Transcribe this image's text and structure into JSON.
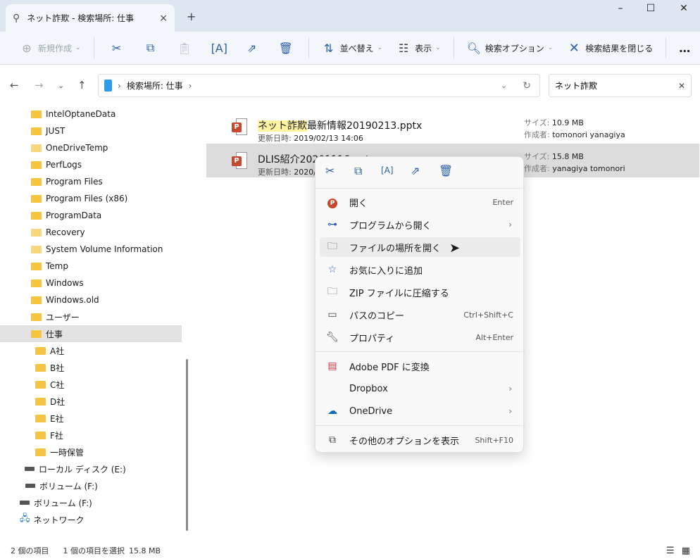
{
  "window": {
    "tab_title": "ネット詐欺 - 検索場所: 仕事",
    "new_tab": "+",
    "close_tab": "×",
    "minimize": "–",
    "maximize": "☐",
    "close": "✕"
  },
  "toolbar": {
    "new": "新規作成",
    "sort": "並べ替え",
    "view": "表示",
    "search_options": "検索オプション",
    "close_search": "検索結果を閉じる",
    "more": "…"
  },
  "address": {
    "path": "検索場所: 仕事",
    "search_value": "ネット詐欺"
  },
  "sidebar": {
    "items": [
      {
        "label": "IntelOptaneData",
        "type": "folder"
      },
      {
        "label": "JUST",
        "type": "folder"
      },
      {
        "label": "OneDriveTemp",
        "type": "folder-light"
      },
      {
        "label": "PerfLogs",
        "type": "folder"
      },
      {
        "label": "Program Files",
        "type": "folder"
      },
      {
        "label": "Program Files (x86)",
        "type": "folder"
      },
      {
        "label": "ProgramData",
        "type": "folder"
      },
      {
        "label": "Recovery",
        "type": "folder-light"
      },
      {
        "label": "System Volume Information",
        "type": "folder-light"
      },
      {
        "label": "Temp",
        "type": "folder"
      },
      {
        "label": "Windows",
        "type": "folder"
      },
      {
        "label": "Windows.old",
        "type": "folder"
      },
      {
        "label": "ユーザー",
        "type": "folder"
      },
      {
        "label": "仕事",
        "type": "folder",
        "selected": true
      },
      {
        "label": "A社",
        "type": "folder",
        "sub": true
      },
      {
        "label": "B社",
        "type": "folder",
        "sub": true
      },
      {
        "label": "C社",
        "type": "folder",
        "sub": true
      },
      {
        "label": "D社",
        "type": "folder",
        "sub": true
      },
      {
        "label": "E社",
        "type": "folder",
        "sub": true
      },
      {
        "label": "F社",
        "type": "folder",
        "sub": true
      },
      {
        "label": "一時保管",
        "type": "folder",
        "sub": true
      },
      {
        "label": "ローカル ディスク (E:)",
        "type": "drive"
      },
      {
        "label": "ボリューム (F:)",
        "type": "drive"
      },
      {
        "label": "ボリューム (F:)",
        "type": "drive2"
      },
      {
        "label": "ネットワーク",
        "type": "network"
      }
    ]
  },
  "files": [
    {
      "highlight": "ネット詐欺",
      "name_rest": "最新情報20190213.pptx",
      "modified_label": "更新日時:",
      "modified": "2019/02/13 14:06",
      "size_label": "サイズ:",
      "size": "10.9 MB",
      "author_label": "作成者:",
      "author": "tomonori yanagiya"
    },
    {
      "highlight": "",
      "name_rest": "DLIS紹介20201116.pptx",
      "modified_label": "更新日時:",
      "modified": "2020/11/16",
      "size_label": "サイズ:",
      "size": "15.8 MB",
      "author_label": "作成者:",
      "author": "yanagiya tomonori"
    }
  ],
  "context_menu": {
    "items": [
      {
        "label": "開く",
        "shortcut": "Enter",
        "icon": "powerpoint-icon"
      },
      {
        "label": "プログラムから開く",
        "shortcut": "",
        "arrow": "›",
        "icon": "open-with-icon"
      },
      {
        "label": "ファイルの場所を開く",
        "shortcut": "",
        "icon": "folder-open-icon"
      },
      {
        "label": "お気に入りに追加",
        "shortcut": "",
        "icon": "star-icon"
      },
      {
        "label": "ZIP ファイルに圧縮する",
        "shortcut": "",
        "icon": "zip-icon"
      },
      {
        "label": "パスのコピー",
        "shortcut": "Ctrl+Shift+C",
        "icon": "copy-path-icon"
      },
      {
        "label": "プロパティ",
        "shortcut": "Alt+Enter",
        "icon": "wrench-icon"
      },
      {
        "label": "Adobe PDF に変換",
        "shortcut": "",
        "icon": "pdf-icon"
      },
      {
        "label": "Dropbox",
        "shortcut": "",
        "arrow": "›",
        "icon": ""
      },
      {
        "label": "OneDrive",
        "shortcut": "",
        "arrow": "›",
        "icon": "onedrive-icon"
      },
      {
        "label": "その他のオプションを表示",
        "shortcut": "Shift+F10",
        "icon": "more-options-icon"
      }
    ]
  },
  "status": {
    "count": "2 個の項目",
    "selected": "1 個の項目を選択",
    "size": "15.8 MB"
  }
}
